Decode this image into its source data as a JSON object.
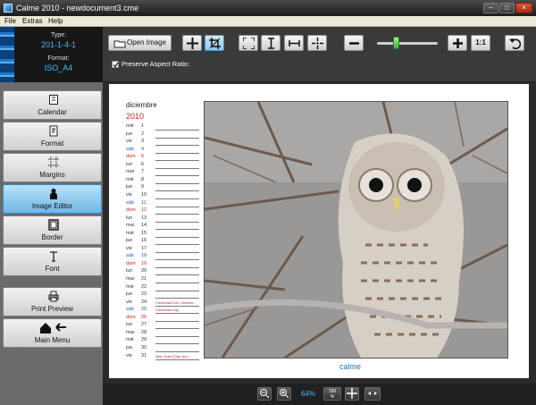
{
  "window": {
    "title": "Calme 2010 - newdocument3.cme",
    "minimize": "–",
    "maximize": "□",
    "close": "×"
  },
  "menu": [
    "File",
    "Extras",
    "Help"
  ],
  "info": {
    "type_label": "Type:",
    "type_value": "201-1-4-1",
    "format_label": "Format:",
    "format_value": "ISO_A4"
  },
  "sidebar": {
    "items": [
      {
        "label": "Calendar",
        "icon": "calendar-icon"
      },
      {
        "label": "Format",
        "icon": "format-icon"
      },
      {
        "label": "Margins",
        "icon": "margins-icon"
      },
      {
        "label": "Image Editor",
        "icon": "person-icon"
      },
      {
        "label": "Border",
        "icon": "border-icon"
      },
      {
        "label": "Font",
        "icon": "font-icon"
      },
      {
        "label": "Print Preview",
        "icon": "printer-icon"
      },
      {
        "label": "Main Menu",
        "icon": "home-back-icon"
      }
    ]
  },
  "toolbar": {
    "open_image": "Open Image",
    "one_to_one": "1:1",
    "preserve_label": "Preserve Aspect Ratio:",
    "preserve_checked": true,
    "icons": [
      "move-icon",
      "crop-icon",
      "fit-icon",
      "fit-height-icon",
      "fit-width-icon",
      "center-icon",
      "zoom-out-icon",
      "zoom-in-icon",
      "undo-icon"
    ],
    "zoom_slider_fraction": 0.3
  },
  "calendar": {
    "month": "diciembre",
    "year": "2010",
    "days": [
      {
        "d": "mié",
        "n": "1"
      },
      {
        "d": "jue",
        "n": "2"
      },
      {
        "d": "vie",
        "n": "3"
      },
      {
        "d": "sáb",
        "n": "4",
        "c": "blue"
      },
      {
        "d": "dom",
        "n": "5",
        "c": "red"
      },
      {
        "d": "lun",
        "n": "6"
      },
      {
        "d": "mar",
        "n": "7"
      },
      {
        "d": "mié",
        "n": "8"
      },
      {
        "d": "jue",
        "n": "9"
      },
      {
        "d": "vie",
        "n": "10"
      },
      {
        "d": "sáb",
        "n": "11",
        "c": "blue"
      },
      {
        "d": "dom",
        "n": "12",
        "c": "red"
      },
      {
        "d": "lun",
        "n": "13"
      },
      {
        "d": "mar",
        "n": "14"
      },
      {
        "d": "mié",
        "n": "15"
      },
      {
        "d": "jue",
        "n": "16"
      },
      {
        "d": "vie",
        "n": "17"
      },
      {
        "d": "sáb",
        "n": "18",
        "c": "blue"
      },
      {
        "d": "dom",
        "n": "19",
        "c": "red"
      },
      {
        "d": "lun",
        "n": "20"
      },
      {
        "d": "mar",
        "n": "21"
      },
      {
        "d": "mié",
        "n": "22"
      },
      {
        "d": "jue",
        "n": "23"
      },
      {
        "d": "vie",
        "n": "24",
        "note": "Christmas Eve, Christm..."
      },
      {
        "d": "sáb",
        "n": "25",
        "c": "blue",
        "note": "Christmas Day"
      },
      {
        "d": "dom",
        "n": "26",
        "c": "red"
      },
      {
        "d": "lun",
        "n": "27"
      },
      {
        "d": "mar",
        "n": "28"
      },
      {
        "d": "mié",
        "n": "29"
      },
      {
        "d": "jue",
        "n": "30"
      },
      {
        "d": "vie",
        "n": "31",
        "note": "New Year's Day, doc..."
      }
    ]
  },
  "logo": {
    "text": "calme"
  },
  "bottom": {
    "zoom": "64%",
    "hundred": "100",
    "percent_sign": "%"
  },
  "colors": {
    "accent": "#47b6ff",
    "weekend_red": "#c22",
    "weekend_blue": "#1a5fd0"
  }
}
